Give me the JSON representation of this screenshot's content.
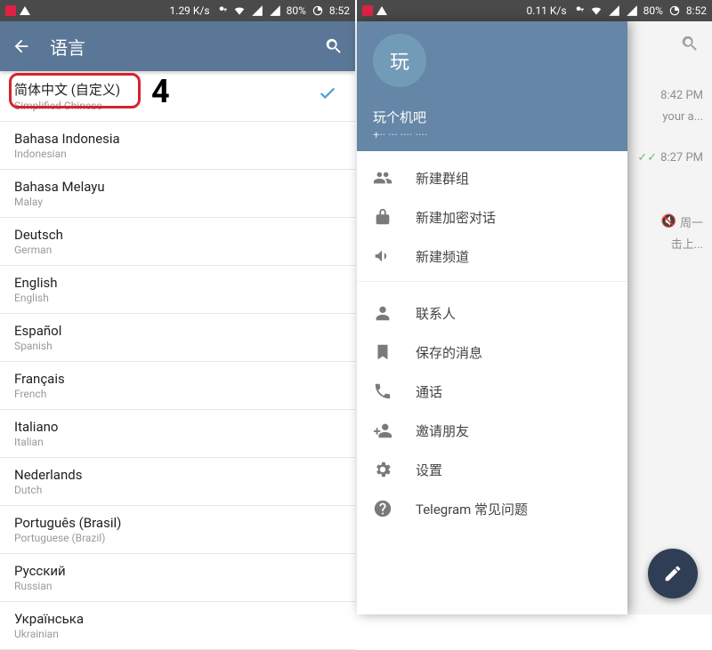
{
  "status": {
    "speed_left": "1.29 K/s",
    "speed_right": "0.11 K/s",
    "battery_left": "80%",
    "battery_right": "80%",
    "clock": "8:52"
  },
  "left": {
    "title": "语言",
    "selected_check": true,
    "annotation_number": "4",
    "items": [
      {
        "native": "简体中文 (自定义)",
        "eng": "Simplified Chinese",
        "selected": true
      },
      {
        "native": "Bahasa Indonesia",
        "eng": "Indonesian"
      },
      {
        "native": "Bahasa Melayu",
        "eng": "Malay"
      },
      {
        "native": "Deutsch",
        "eng": "German"
      },
      {
        "native": "English",
        "eng": "English"
      },
      {
        "native": "Español",
        "eng": "Spanish"
      },
      {
        "native": "Français",
        "eng": "French"
      },
      {
        "native": "Italiano",
        "eng": "Italian"
      },
      {
        "native": "Nederlands",
        "eng": "Dutch"
      },
      {
        "native": "Português (Brasil)",
        "eng": "Portuguese (Brazil)"
      },
      {
        "native": "Русский",
        "eng": "Russian"
      },
      {
        "native": "Українська",
        "eng": "Ukrainian"
      }
    ]
  },
  "right": {
    "avatar_letter": "玩",
    "username": "玩个机吧",
    "phone_masked": "+·· ··· ···· ····",
    "bg_rows": [
      {
        "time": "8:42 PM",
        "snippet": "your a..."
      },
      {
        "time": "8:27 PM",
        "ticks": "✓✓"
      },
      {
        "time": "周一",
        "snippet": "击上...",
        "muted": true
      }
    ],
    "menu": [
      {
        "icon": "group",
        "label": "新建群组"
      },
      {
        "icon": "lock",
        "label": "新建加密对话"
      },
      {
        "icon": "megaphone",
        "label": "新建频道"
      },
      {
        "icon": "contact",
        "label": "联系人"
      },
      {
        "icon": "bookmark",
        "label": "保存的消息"
      },
      {
        "icon": "phone",
        "label": "通话"
      },
      {
        "icon": "invite",
        "label": "邀请朋友"
      },
      {
        "icon": "settings",
        "label": "设置"
      },
      {
        "icon": "help",
        "label": "Telegram 常见问题"
      }
    ]
  }
}
